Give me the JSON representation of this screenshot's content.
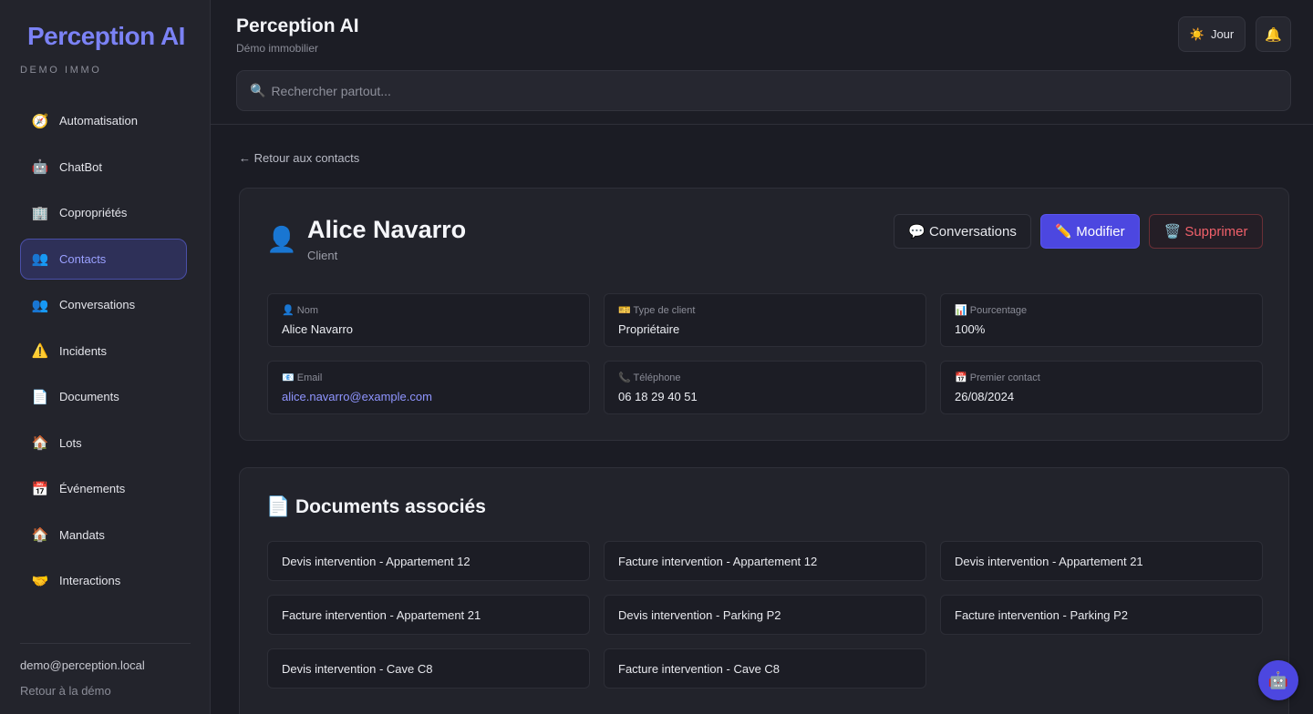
{
  "sidebar": {
    "brand": "Perception AI",
    "brand_sub": "DEMO IMMO",
    "items": [
      {
        "label": "Automatisation",
        "icon": "🧭",
        "name": "sidebar-item-automatisation"
      },
      {
        "label": "ChatBot",
        "icon": "🤖",
        "name": "sidebar-item-chatbot"
      },
      {
        "label": "Copropriétés",
        "icon": "🏢",
        "name": "sidebar-item-coproprietes"
      },
      {
        "label": "Contacts",
        "icon": "👥",
        "name": "sidebar-item-contacts",
        "active": true
      },
      {
        "label": "Conversations",
        "icon": "👥",
        "name": "sidebar-item-conversations"
      },
      {
        "label": "Incidents",
        "icon": "⚠️",
        "name": "sidebar-item-incidents"
      },
      {
        "label": "Documents",
        "icon": "📄",
        "name": "sidebar-item-documents"
      },
      {
        "label": "Lots",
        "icon": "🏠",
        "name": "sidebar-item-lots"
      },
      {
        "label": "Événements",
        "icon": "📅",
        "name": "sidebar-item-evenements"
      },
      {
        "label": "Mandats",
        "icon": "🏠",
        "name": "sidebar-item-mandats"
      },
      {
        "label": "Interactions",
        "icon": "🤝",
        "name": "sidebar-item-interactions"
      }
    ],
    "user_email": "demo@perception.local",
    "back_demo": "Retour à la démo"
  },
  "header": {
    "title": "Perception AI",
    "subtitle": "Démo immobilier",
    "theme_label": "Jour",
    "theme_icon": "☀️",
    "bell_icon": "🔔",
    "search_placeholder": "Rechercher partout..."
  },
  "main": {
    "back_link": "← Retour aux contacts",
    "contact": {
      "avatar_icon": "👤",
      "name": "Alice Navarro",
      "role": "Client",
      "buttons": {
        "conversations": "💬 Conversations",
        "edit": "✏️ Modifier",
        "delete": "🗑️ Supprimer"
      },
      "fields": [
        {
          "label": "👤 Nom",
          "value": "Alice Navarro"
        },
        {
          "label": "🎫 Type de client",
          "value": "Propriétaire"
        },
        {
          "label": "📊 Pourcentage",
          "value": "100%"
        },
        {
          "label": "📧 Email",
          "value": "alice.navarro@example.com"
        },
        {
          "label": "📞 Téléphone",
          "value": "06 18 29 40 51"
        },
        {
          "label": "📅 Premier contact",
          "value": "26/08/2024"
        }
      ]
    },
    "documents": {
      "title": "📄 Documents associés",
      "items": [
        "Devis intervention - Appartement 12",
        "Facture intervention - Appartement 12",
        "Devis intervention - Appartement 21",
        "Facture intervention - Appartement 21",
        "Devis intervention - Parking P2",
        "Facture intervention - Parking P2",
        "Devis intervention - Cave C8",
        "Facture intervention - Cave C8"
      ]
    },
    "fab_icon": "🤖"
  }
}
